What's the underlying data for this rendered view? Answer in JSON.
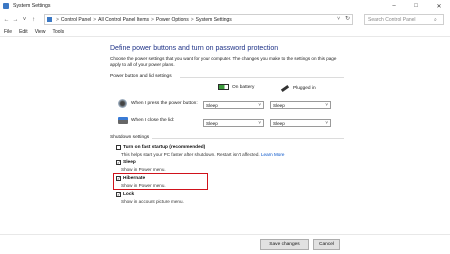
{
  "window": {
    "title": "System Settings",
    "minimize_glyph": "–",
    "maximize_glyph": "□",
    "close_glyph": "✕"
  },
  "nav": {
    "back_glyph": "←",
    "forward_glyph": "→",
    "recent_glyph": "˅",
    "up_glyph": "↑"
  },
  "address": {
    "crumbs": [
      "Control Panel",
      "All Control Panel Items",
      "Power Options",
      "System Settings"
    ],
    "separator": ">",
    "dropdown_glyph": "˅",
    "refresh_glyph": "↻"
  },
  "search": {
    "placeholder": "Search Control Panel",
    "icon": "search-icon",
    "icon_glyph": "⌕"
  },
  "menu": [
    "File",
    "Edit",
    "View",
    "Tools"
  ],
  "main": {
    "heading": "Define power buttons and turn on password protection",
    "intro": "Choose the power settings that you want for your computer. The changes you make to the settings on this page apply to all of your power plans.",
    "power_section_title": "Power button and lid settings",
    "col_battery": "On battery",
    "col_plugged": "Plugged in",
    "rows": [
      {
        "label": "When I press the power button:",
        "battery": "Sleep",
        "plugged": "Sleep"
      },
      {
        "label": "When I close the lid:",
        "battery": "Sleep",
        "plugged": "Sleep"
      }
    ],
    "caret_glyph": "˅",
    "shutdown_section_title": "Shutdown settings",
    "shutdown": [
      {
        "title": "Turn on fast startup (recommended)",
        "desc": "This helps start your PC faster after shutdown. Restart isn't affected.",
        "link": "Learn More",
        "checked": false
      },
      {
        "title": "Sleep",
        "desc": "Show in Power menu.",
        "checked": true
      },
      {
        "title": "Hibernate",
        "desc": "Show in Power menu.",
        "checked": true
      },
      {
        "title": "Lock",
        "desc": "Show in account picture menu.",
        "checked": true
      }
    ],
    "check_glyph": "✓"
  },
  "buttons": {
    "save": "Save changes",
    "cancel": "Cancel"
  },
  "colors": {
    "heading": "#1e3287",
    "highlight": "#d0121b",
    "link": "#0050c8"
  }
}
